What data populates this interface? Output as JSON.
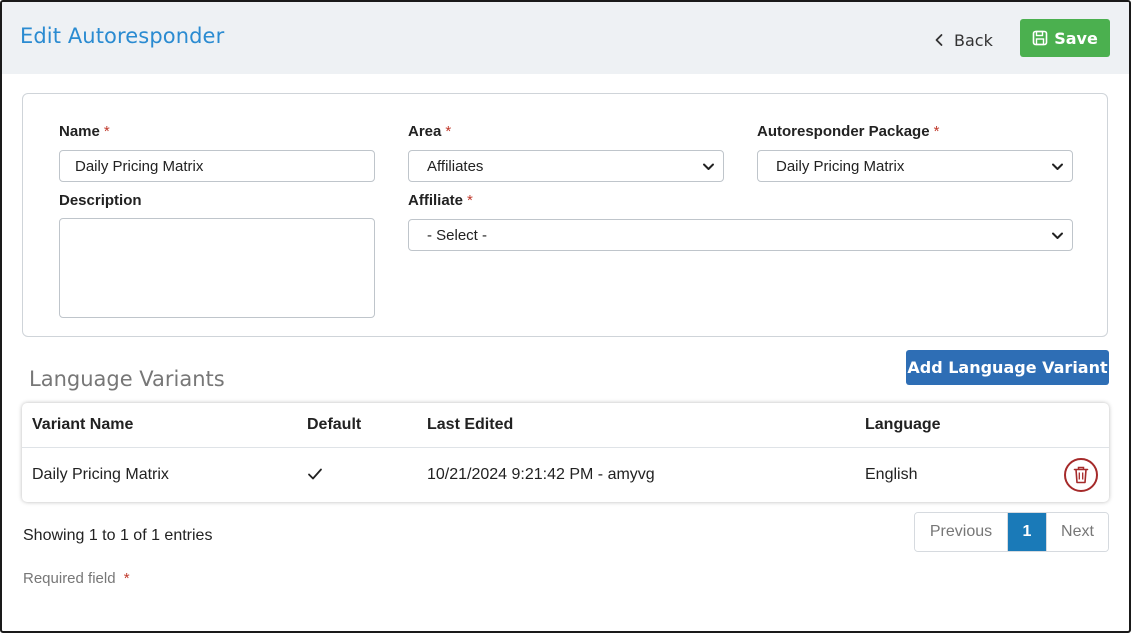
{
  "header": {
    "title": "Edit Autoresponder",
    "back_label": "Back",
    "save_label": "Save"
  },
  "form": {
    "name": {
      "label": "Name",
      "required_mark": "*",
      "value": "Daily Pricing Matrix"
    },
    "area": {
      "label": "Area",
      "required_mark": "*",
      "value": "Affiliates"
    },
    "package": {
      "label": "Autoresponder Package",
      "required_mark": "*",
      "value": "Daily Pricing Matrix"
    },
    "description": {
      "label": "Description",
      "value": ""
    },
    "affiliate": {
      "label": "Affiliate",
      "required_mark": "*",
      "value": "- Select -"
    }
  },
  "variants": {
    "section_title": "Language Variants",
    "add_label": "Add Language Variant",
    "columns": [
      "Variant Name",
      "Default",
      "Last Edited",
      "Language"
    ],
    "rows": [
      {
        "variant_name": "Daily Pricing Matrix",
        "default": true,
        "last_edited": "10/21/2024 9:21:42 PM - amyvg",
        "language": "English"
      }
    ]
  },
  "pagination": {
    "info": "Showing 1 to 1 of 1 entries",
    "previous": "Previous",
    "current": "1",
    "next": "Next"
  },
  "footer": {
    "required_text": "Required field",
    "required_mark": "*"
  },
  "icons": {
    "back": "chevron-left-icon",
    "save": "floppy-disk-icon",
    "select": "chevron-down-icon",
    "default": "checkmark-icon",
    "delete": "trash-icon"
  },
  "colors": {
    "title": "#2a8bd1",
    "save": "#4bb04f",
    "primary": "#2e6eb5",
    "active_page": "#1a7ab8",
    "required": "#c0392b",
    "delete": "#a52a2a",
    "header_bg": "#eef1f4"
  }
}
